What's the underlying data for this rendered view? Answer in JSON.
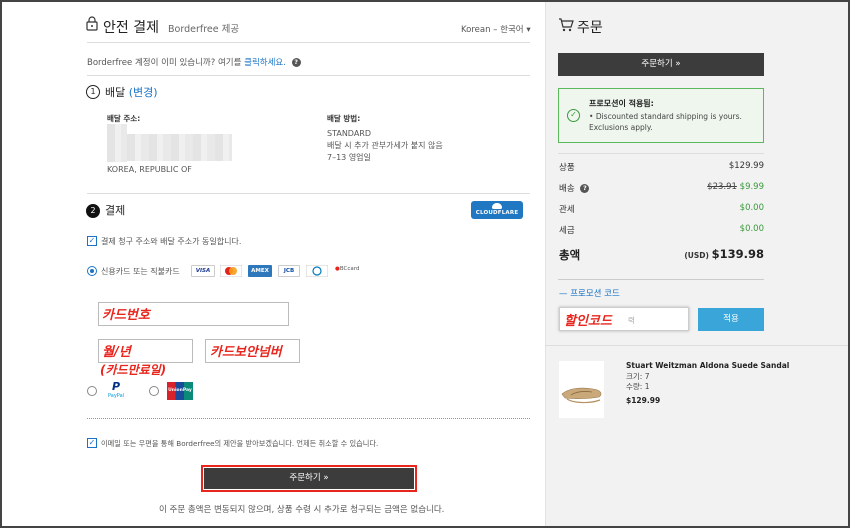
{
  "header": {
    "title": "안전 결제",
    "subtitle": "Borderfree 제공",
    "language": "Korean – 한국어"
  },
  "login_prompt": {
    "text": "Borderfree 계정이 이미 있습니까? 여기를",
    "link": "클릭하세요."
  },
  "delivery": {
    "step": "1",
    "title": "배달",
    "change_link": "(변경)",
    "address_label": "배달 주소:",
    "address_country": "KOREA, REPUBLIC OF",
    "method_label": "배달 방법:",
    "method_lines": [
      "STANDARD",
      "배달 시 추가 관부가세가 붙지 않음",
      "7–13 영업일"
    ]
  },
  "payment": {
    "step": "2",
    "title": "결제",
    "badge": "CLOUDFLARE",
    "same_address_text": "결제 청구 주소와 배달 주소가 동일합니다.",
    "card_option": "신용카드 또는 직불카드",
    "card_logos": [
      "VISA",
      "MC",
      "AMEX",
      "JCB",
      "Diners",
      "BCcard"
    ],
    "card_number_annotation": "카드번호",
    "expiry_annotation_line1": "월/년",
    "expiry_annotation_line2": "(카드만료일)",
    "cvc_annotation": "카드보안넘버",
    "paypal_label": "PayPal",
    "unionpay_label": "UnionPay",
    "email_consent": "이메일 또는 우편을 통해 Borderfree의 제안을 받아보겠습니다. 언제든 취소할 수 있습니다.",
    "place_order": "주문하기 »",
    "footer_note": "이 주문 총액은 변동되지 않으며, 상품 수령 시 추가로 청구되는 금액은 없습니다."
  },
  "order": {
    "title": "주문",
    "place_order": "주문하기 »",
    "promo_applied_title": "프로모션이 적용됨:",
    "promo_applied_items": [
      "Discounted standard shipping is yours. Exclusions apply."
    ],
    "rows": {
      "items_label": "상품",
      "items_value": "$129.99",
      "shipping_label": "배송",
      "shipping_old": "$23.91",
      "shipping_new": "$9.99",
      "duties_label": "관세",
      "duties_value": "$0.00",
      "taxes_label": "세금",
      "taxes_value": "$0.00",
      "total_label": "총액",
      "total_currency": "(USD)",
      "total_value": "$139.98"
    },
    "promo_code_link": "— 프로모션 코드",
    "promo_annotation": "할인코드",
    "promo_placeholder": "력",
    "apply_button": "적용",
    "product": {
      "name": "Stuart Weitzman Aldona Suede Sandal",
      "size": "크기: 7",
      "quantity": "수량: 1",
      "price": "$129.99"
    }
  },
  "colors": {
    "accent_blue": "#1a73c7",
    "annotation_red": "#e8261e",
    "promo_green": "#3a9a3a",
    "apply_blue": "#3aa5d8",
    "dark_button": "#3c3c3c"
  }
}
